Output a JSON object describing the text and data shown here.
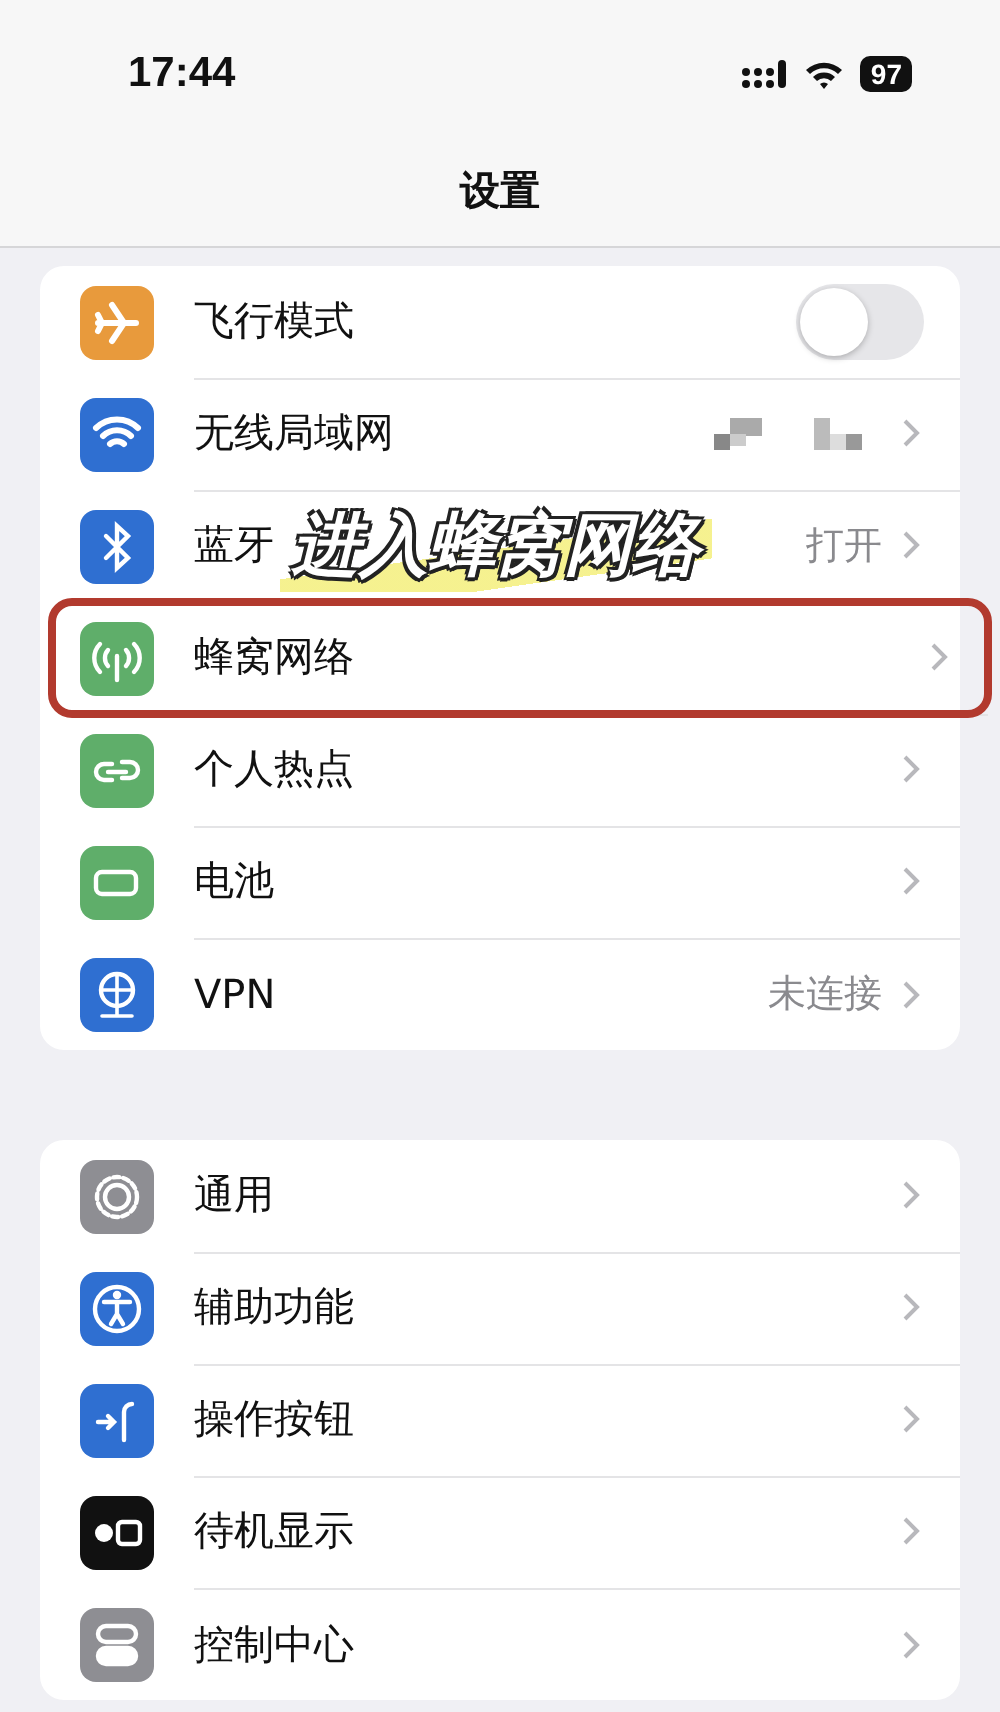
{
  "status_bar": {
    "time": "17:44",
    "battery": "97"
  },
  "nav": {
    "title": "设置"
  },
  "groups": [
    {
      "rows": [
        {
          "label": "飞行模式",
          "kind": "toggle",
          "on": false,
          "color": "#e89a3c",
          "highlighted": false
        },
        {
          "label": "无线局域网",
          "kind": "masked",
          "color": "#2f6fd1",
          "highlighted": false
        },
        {
          "label": "蓝牙",
          "kind": "link",
          "value": "打开",
          "color": "#2f6fd1",
          "highlighted": false
        },
        {
          "label": "蜂窝网络",
          "kind": "link",
          "color": "#5fae6a",
          "highlighted": true
        },
        {
          "label": "个人热点",
          "kind": "link",
          "color": "#5fae6a",
          "highlighted": false
        },
        {
          "label": "电池",
          "kind": "link",
          "color": "#5fae6a",
          "highlighted": false
        },
        {
          "label": "VPN",
          "kind": "link",
          "value": "未连接",
          "color": "#2f6fd1",
          "highlighted": false
        }
      ]
    },
    {
      "rows": [
        {
          "label": "通用",
          "kind": "link",
          "color": "#8e8e93",
          "highlighted": false
        },
        {
          "label": "辅助功能",
          "kind": "link",
          "color": "#2f6fd1",
          "highlighted": false
        },
        {
          "label": "操作按钮",
          "kind": "link",
          "color": "#2f6fd1",
          "highlighted": false
        },
        {
          "label": "待机显示",
          "kind": "link",
          "color": "#111111",
          "highlighted": false
        },
        {
          "label": "控制中心",
          "kind": "link",
          "color": "#8e8e93",
          "highlighted": false
        }
      ]
    }
  ],
  "annotation": {
    "text": "进入蜂窝网络"
  }
}
